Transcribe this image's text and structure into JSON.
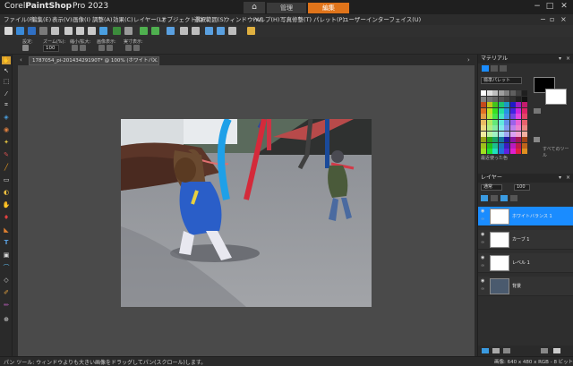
{
  "app": {
    "brand_prefix": "Corel",
    "brand_main": "PaintShop",
    "brand_suffix": "Pro 2023",
    "mode_manage": "管理",
    "mode_edit": "編集"
  },
  "window_controls": {
    "minimize": "−",
    "maximize": "□",
    "close": "✕"
  },
  "menu": {
    "items": [
      "ファイル(F)",
      "編集(E)",
      "表示(V)",
      "画像(I)",
      "調整(A)",
      "効果(C)",
      "レイヤー(L)",
      "オブジェクト(O)",
      "選択範囲(S)",
      "ウィンドウ(W)",
      "ヘルプ(H)",
      "写真修整(T)",
      "パレット(P)",
      "ユーザーインターフェイス(U)"
    ]
  },
  "options_bar": {
    "labels": [
      "設定:",
      "ズーム(%):",
      "縮小/拡大:",
      "画像表示:",
      "実寸表示:"
    ],
    "zoom_value": "100"
  },
  "document": {
    "tab_title": "1787054_pi-20143429190T* @ 100% (ホワイトバ...",
    "tab_close": "×"
  },
  "status": {
    "left": "パン ツール: ウィンドウよりも大きい画像をドラッグしてパン(スクロール)します。",
    "right": "画像: 640 x 480 x RGB - 8 ビット/チャネル"
  },
  "materials": {
    "title": "マテリアル",
    "palette_select": "標準パレット",
    "all_tools": "すべてのツール",
    "recent_label": "最近使った色"
  },
  "layers": {
    "title": "レイヤー",
    "blend_mode": "通常",
    "opacity": "100",
    "items": [
      {
        "name": "ホワイトバランス 1",
        "selected": true
      },
      {
        "name": "カーブ 1",
        "selected": false
      },
      {
        "name": "レベル 1",
        "selected": false
      },
      {
        "name": "背景",
        "selected": false
      }
    ]
  },
  "colors": {
    "accent_edit": "#e0741a",
    "selected_layer": "#1a8cff",
    "canvas_bg": "#4a4a4a"
  }
}
